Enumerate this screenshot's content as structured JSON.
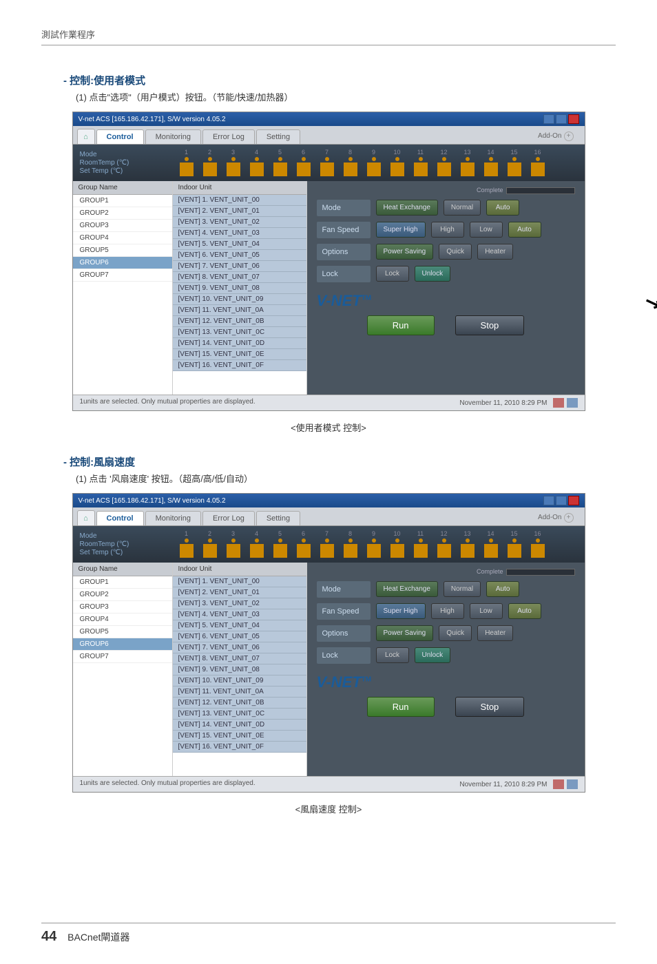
{
  "header": "測試作業程序",
  "section1": {
    "title": "- 控制:使用者模式",
    "desc": "(1) 点击\"选项\"（用户模式）按钮。（节能/快速/加热器）",
    "caption": "<使用者模式 控制>"
  },
  "section2": {
    "title": "- 控制:風扇速度",
    "desc": "(1) 点击 '风扇速度' 按钮。（超高/高/低/自动）",
    "caption": "<風扇速度 控制>"
  },
  "app": {
    "title": "V-net ACS [165.186.42.171],   S/W version 4.05.2",
    "tabs": {
      "home": "⌂",
      "control": "Control",
      "monitoring": "Monitoring",
      "errorlog": "Error Log",
      "setting": "Setting",
      "addon": "Add-On"
    },
    "modepanel": {
      "mode": "Mode",
      "roomtemp": "RoomTemp (℃)",
      "settemp": "Set Temp  (℃)"
    },
    "slot_nums": [
      "1",
      "2",
      "3",
      "4",
      "5",
      "6",
      "7",
      "8",
      "9",
      "10",
      "11",
      "12",
      "13",
      "14",
      "15",
      "16"
    ],
    "group_head": "Group Name",
    "groups": [
      "GROUP1",
      "GROUP2",
      "GROUP3",
      "GROUP4",
      "GROUP5",
      "GROUP6",
      "GROUP7"
    ],
    "group_selected": "GROUP6",
    "unit_head": "Indoor Unit",
    "units": [
      "[VENT] 1. VENT_UNIT_00",
      "[VENT] 2. VENT_UNIT_01",
      "[VENT] 3. VENT_UNIT_02",
      "[VENT] 4. VENT_UNIT_03",
      "[VENT] 5. VENT_UNIT_04",
      "[VENT] 6. VENT_UNIT_05",
      "[VENT] 7. VENT_UNIT_06",
      "[VENT] 8. VENT_UNIT_07",
      "[VENT] 9. VENT_UNIT_08",
      "[VENT] 10. VENT_UNIT_09",
      "[VENT] 11. VENT_UNIT_0A",
      "[VENT] 12. VENT_UNIT_0B",
      "[VENT] 13. VENT_UNIT_0C",
      "[VENT] 14. VENT_UNIT_0D",
      "[VENT] 15. VENT_UNIT_0E",
      "[VENT] 16. VENT_UNIT_0F"
    ],
    "complete": "Complete",
    "rows": {
      "mode": "Mode",
      "mode_btns": [
        "Heat Exchange",
        "Normal",
        "Auto"
      ],
      "fan": "Fan Speed",
      "fan_btns": [
        "Super High",
        "High",
        "Low",
        "Auto"
      ],
      "options": "Options",
      "options_btns": [
        "Power Saving",
        "Quick",
        "Heater"
      ],
      "lock": "Lock",
      "lock_btns": [
        "Lock",
        "Unlock"
      ]
    },
    "vnet_logo": "V-NET",
    "tm": "TM",
    "run": "Run",
    "stop": "Stop",
    "status_left": "1units are selected. Only mutual properties are displayed.",
    "status_right": "November 11, 2010  8:29 PM"
  },
  "footer": {
    "page": "44",
    "product": "BACnet閘道器"
  }
}
